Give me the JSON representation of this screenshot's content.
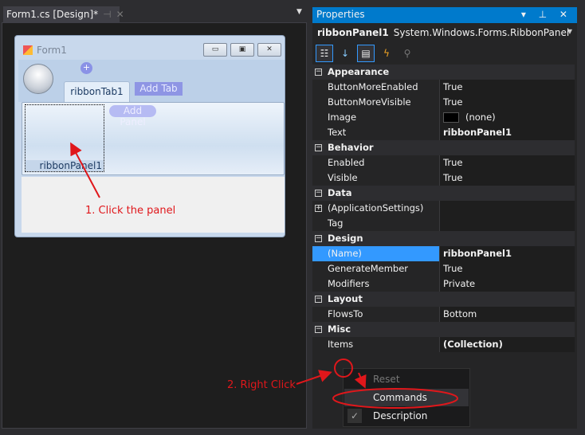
{
  "doc_tab": {
    "title": "Form1.cs [Design]*",
    "pin": "⊣",
    "close": "✕",
    "menu": "▼"
  },
  "form": {
    "title": "Form1",
    "min": "▭",
    "max": "▣",
    "close": "✕",
    "tab": "ribbonTab1",
    "add_tab": "Add Tab",
    "add_panel": "Add Panel",
    "panel": "ribbonPanel1",
    "qat_add": "+"
  },
  "annotations": {
    "step1": "1. Click the panel",
    "step2": "2. Right Click",
    "color": "#e0171b"
  },
  "properties": {
    "title": "Properties",
    "title_buttons": "▾ ⊥ ✕",
    "object_name": "ribbonPanel1",
    "object_type": "System.Windows.Forms.RibbonPanel",
    "dropdown": "▼",
    "toolbar": [
      "categorized-icon",
      "alphabetical-icon",
      "properties-icon",
      "events-icon",
      "property-pages-icon"
    ],
    "rows": [
      {
        "type": "cat",
        "name": "Appearance"
      },
      {
        "name": "ButtonMoreEnabled",
        "value": "True"
      },
      {
        "name": "ButtonMoreVisible",
        "value": "True"
      },
      {
        "name": "Image",
        "value": "(none)",
        "swatch": true
      },
      {
        "name": "Text",
        "value": "ribbonPanel1",
        "bold": true
      },
      {
        "type": "cat",
        "name": "Behavior"
      },
      {
        "name": "Enabled",
        "value": "True"
      },
      {
        "name": "Visible",
        "value": "True"
      },
      {
        "type": "cat",
        "name": "Data"
      },
      {
        "name": "(ApplicationSettings)",
        "value": "",
        "expand": true
      },
      {
        "name": "Tag",
        "value": ""
      },
      {
        "type": "cat",
        "name": "Design"
      },
      {
        "name": "(Name)",
        "value": "ribbonPanel1",
        "bold": true,
        "selected": true
      },
      {
        "name": "GenerateMember",
        "value": "True"
      },
      {
        "name": "Modifiers",
        "value": "Private"
      },
      {
        "type": "cat",
        "name": "Layout"
      },
      {
        "name": "FlowsTo",
        "value": "Bottom"
      },
      {
        "type": "cat",
        "name": "Misc"
      },
      {
        "name": "Items",
        "value": "(Collection)",
        "bold": true
      }
    ]
  },
  "context_menu": [
    {
      "label": "Reset",
      "disabled": true
    },
    {
      "label": "Commands",
      "highlighted": true
    },
    {
      "label": "Description",
      "checked": true
    }
  ]
}
